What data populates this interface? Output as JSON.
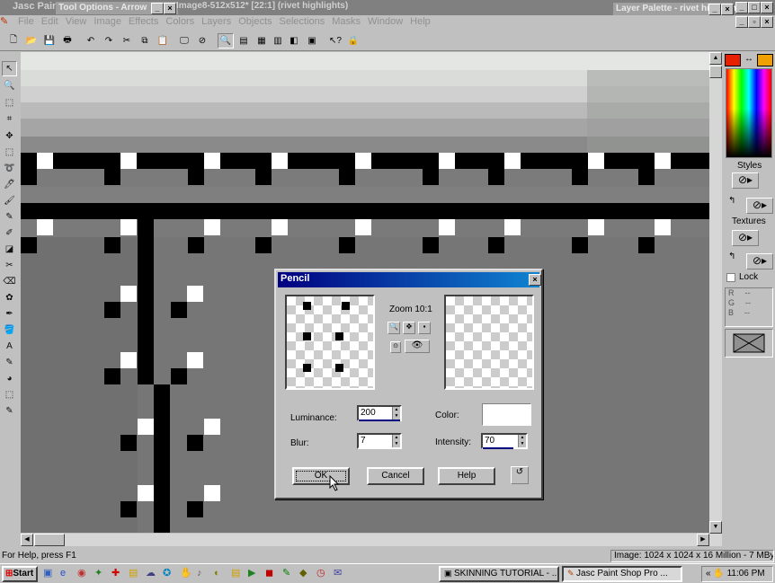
{
  "app_title": "Jasc Paint Shop Pro",
  "doc_title": "Image8-512x512* [22:1] (rivet highlights)",
  "tool_options_title": "Tool Options - Arrow",
  "layer_palette_title": "Layer Palette - rivet highlights",
  "menu": [
    "File",
    "Edit",
    "View",
    "Image",
    "Effects",
    "Colors",
    "Layers",
    "Objects",
    "Selections",
    "Masks",
    "Window",
    "Help"
  ],
  "palette": {
    "styles_label": "Styles",
    "textures_label": "Textures",
    "lock_label": "Lock",
    "rgb": [
      {
        "k": "R",
        "v": "--"
      },
      {
        "k": "G",
        "v": "--"
      },
      {
        "k": "B",
        "v": "--"
      }
    ],
    "foreground_color": "#e82000",
    "background_color": "#f0a000"
  },
  "dialog": {
    "title": "Pencil",
    "zoom_label": "Zoom 10:1",
    "luminance_label": "Luminance:",
    "luminance_value": "200",
    "blur_label": "Blur:",
    "blur_value": "7",
    "color_label": "Color:",
    "intensity_label": "Intensity:",
    "intensity_value": "70",
    "ok_label": "OK",
    "cancel_label": "Cancel",
    "help_label": "Help"
  },
  "status": {
    "help_text": "For Help, press F1",
    "image_info": "Image: 1024 x 1024 x 16 Million - 7 MBytes"
  },
  "taskbar": {
    "start_label": "Start",
    "tasks": [
      "SKINNING TUTORIAL - ...",
      "Jasc Paint Shop Pro ..."
    ],
    "clock": "11:06 PM"
  }
}
